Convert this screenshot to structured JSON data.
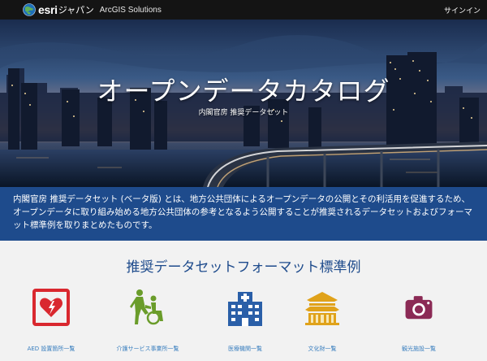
{
  "header": {
    "brand_name": "esri",
    "brand_region": "ジャパン",
    "brand_solutions": "ArcGIS Solutions",
    "signin_label": "サインイン"
  },
  "hero": {
    "title": "オープンデータカタログ",
    "subtitle": "内閣官房 推奨データセット"
  },
  "description": "内閣官房 推奨データセット (ベータ版) とは、地方公共団体によるオープンデータの公開とその利活用を促進するため、オープンデータに取り組み始める地方公共団体の参考となるよう公開することが推奨されるデータセットおよびフォーマット標準例を取りまとめたものです。",
  "section": {
    "title": "推奨データセットフォーマット標準例"
  },
  "categories": [
    {
      "label": "AED 設置箇所一覧",
      "icon": "aed-icon",
      "color": "#d9282f"
    },
    {
      "label": "介護サービス事業所一覧",
      "icon": "caregiver-icon",
      "color": "#6a9c2a"
    },
    {
      "label": "医療機関一覧",
      "icon": "hospital-icon",
      "color": "#2a5fa8"
    },
    {
      "label": "文化財一覧",
      "icon": "cultural-property-icon",
      "color": "#e0a21a"
    },
    {
      "label": "観光施設一覧",
      "icon": "camera-icon",
      "color": "#8b2a55"
    }
  ],
  "colors": {
    "topbar": "#141414",
    "accent_blue": "#1e4b8c",
    "link_blue": "#3a7fbf"
  }
}
